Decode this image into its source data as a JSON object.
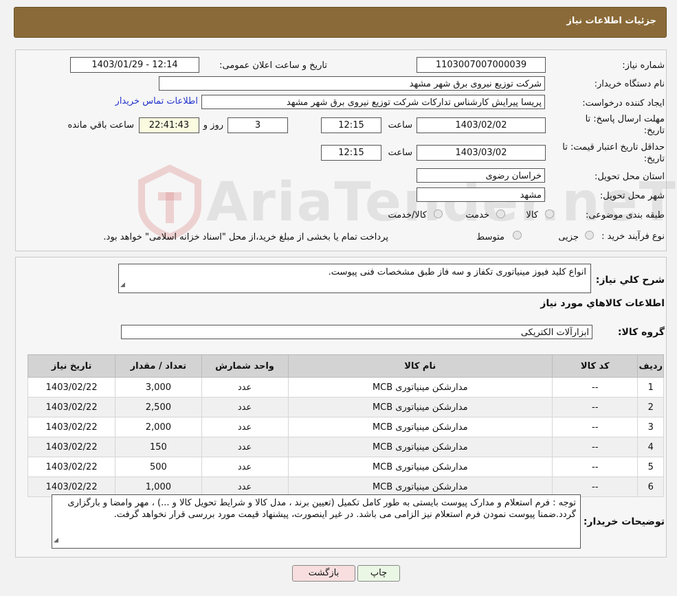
{
  "header": {
    "title": "جزئیات اطلاعات نیاز"
  },
  "form": {
    "need_number_label": "شماره نیاز:",
    "need_number": "1103007007000039",
    "announce_label": "تاریخ و ساعت اعلان عمومی:",
    "announce_value": "1403/01/29 - 12:14",
    "buyer_org_label": "نام دستگاه خریدار:",
    "buyer_org": "شرکت توزیع نیروی برق شهر مشهد",
    "creator_label": "ایجاد کننده درخواست:",
    "creator": "پریسا پیرایش کارشناس تدارکات شرکت توزیع نیروی برق شهر مشهد",
    "contact_link": "اطلاعات تماس خریدار",
    "deadline_label_line1": "مهلت ارسال پاسخ: تا",
    "deadline_label_line2": "تاریخ:",
    "deadline_date": "1403/02/02",
    "time_label": "ساعت",
    "deadline_time": "12:15",
    "days": "3",
    "days_label": "روز و",
    "remaining_time": "22:41:43",
    "remaining_label": "ساعت باقي مانده",
    "validity_label_line1": "حداقل تاریخ اعتبار قیمت: تا",
    "validity_label_line2": "تاریخ:",
    "validity_date": "1403/03/02",
    "validity_time": "12:15",
    "province_label": "استان محل تحویل:",
    "province": "خراسان رضوی",
    "city_label": "شهر محل تحویل:",
    "city": "مشهد",
    "category_label": "طبقه بندی موضوعی:",
    "category_options": [
      "کالا",
      "خدمت",
      "کالا/خدمت"
    ],
    "purchase_type_label": "نوع فرآیند خرید :",
    "purchase_options": [
      "جزیی",
      "متوسط"
    ],
    "purchase_note": "پرداخت تمام یا بخشی از مبلغ خرید،از محل \"اسناد خزانه اسلامی\" خواهد بود."
  },
  "details": {
    "description_label": "شرح کلي نياز:",
    "description": "انواع کلید فیوز مینیاتوری تکفاز و سه فاز طبق مشخصات فنی پیوست.",
    "goods_info_title": "اطلاعات کالاهاي مورد نياز",
    "goods_group_label": "گروه کالا:",
    "goods_group": "ابزارآلات الکتریکی",
    "columns": [
      "ردیف",
      "کد کالا",
      "نام کالا",
      "واحد شمارش",
      "تعداد / مقدار",
      "تاریخ نیاز"
    ],
    "rows": [
      [
        "1",
        "--",
        "مدارشکن مینیاتوری MCB",
        "عدد",
        "3,000",
        "1403/02/22"
      ],
      [
        "2",
        "--",
        "مدارشکن مینیاتوری MCB",
        "عدد",
        "2,500",
        "1403/02/22"
      ],
      [
        "3",
        "--",
        "مدارشکن مینیاتوری MCB",
        "عدد",
        "2,000",
        "1403/02/22"
      ],
      [
        "4",
        "--",
        "مدارشکن مینیاتوری MCB",
        "عدد",
        "150",
        "1403/02/22"
      ],
      [
        "5",
        "--",
        "مدارشکن مینیاتوری MCB",
        "عدد",
        "500",
        "1403/02/22"
      ],
      [
        "6",
        "--",
        "مدارشکن مینیاتوری MCB",
        "عدد",
        "1,000",
        "1403/02/22"
      ]
    ],
    "buyer_notes_label": "توضیحات خریدار:",
    "buyer_notes": "توجه : فرم استعلام و مدارک پیوست بایستی به طور کامل تکمیل (تعیین برند ، مدل کالا و شرایط تحویل کالا و ...) ، مهر وامضا و بارگزاری گردد.ضمنا پیوست نمودن فرم استعلام نیز الزامی می باشد. در غیر اینصورت، پیشنهاد قیمت مورد بررسی قرار نخواهد گرفت."
  },
  "buttons": {
    "print": "چاپ",
    "back": "بازگشت"
  },
  "watermark": {
    "text": "AriaTender.neT"
  }
}
